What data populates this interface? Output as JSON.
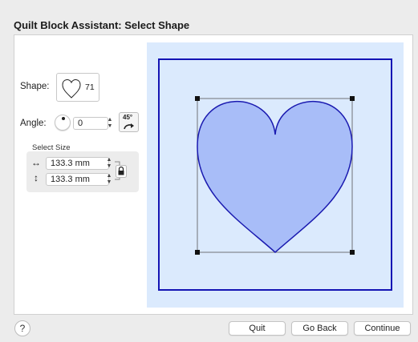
{
  "window": {
    "title": "Quilt Block Assistant: Select Shape"
  },
  "shape": {
    "label": "Shape:",
    "count": "71"
  },
  "angle": {
    "label": "Angle:",
    "value": "0",
    "rotate_label": "45°"
  },
  "size": {
    "group_label": "Select Size",
    "width_value": "133.3 mm",
    "height_value": "133.3 mm"
  },
  "footer": {
    "help_label": "?",
    "quit_label": "Quit",
    "go_back_label": "Go Back",
    "continue_label": "Continue"
  },
  "colors": {
    "canvas_bg": "#dbeafd",
    "frame_stroke": "#1414b4",
    "heart_fill": "#a8bdf8",
    "heart_stroke": "#1a1ab0"
  }
}
